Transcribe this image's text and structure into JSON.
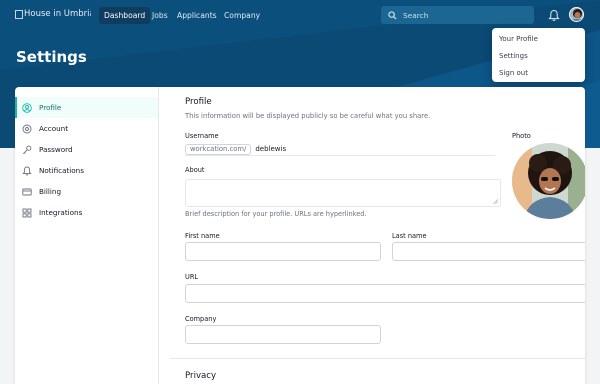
{
  "logo": {
    "alt": "House in Umbria"
  },
  "nav": {
    "items": [
      {
        "label": "Dashboard",
        "active": true
      },
      {
        "label": "Jobs",
        "active": false
      },
      {
        "label": "Applicants",
        "active": false
      },
      {
        "label": "Company",
        "active": false
      }
    ]
  },
  "search": {
    "placeholder": "Search"
  },
  "user_menu": {
    "items": [
      "Your Profile",
      "Settings",
      "Sign out"
    ]
  },
  "page": {
    "title": "Settings"
  },
  "sidebar": {
    "items": [
      {
        "label": "Profile",
        "icon": "user-circle-icon",
        "active": true
      },
      {
        "label": "Account",
        "icon": "cog-icon",
        "active": false
      },
      {
        "label": "Password",
        "icon": "key-icon",
        "active": false
      },
      {
        "label": "Notifications",
        "icon": "bell-icon",
        "active": false
      },
      {
        "label": "Billing",
        "icon": "credit-card-icon",
        "active": false
      },
      {
        "label": "Integrations",
        "icon": "grid-icon",
        "active": false
      }
    ]
  },
  "profile": {
    "title": "Profile",
    "subtitle": "This information will be displayed publicly so be careful what you share.",
    "username_label": "Username",
    "username_prefix": "workcation.com/",
    "username_value": "deblewis",
    "about_label": "About",
    "about_value": "",
    "about_hint": "Brief description for your profile. URLs are hyperlinked.",
    "photo_label": "Photo",
    "first_name_label": "First name",
    "first_name_value": "",
    "last_name_label": "Last name",
    "last_name_value": "",
    "url_label": "URL",
    "url_value": "",
    "company_label": "Company",
    "company_value": ""
  },
  "privacy": {
    "title": "Privacy"
  },
  "colors": {
    "header": "#0b4f7c",
    "accent": "#14b8a6",
    "active_nav": "#0f3c5f"
  }
}
